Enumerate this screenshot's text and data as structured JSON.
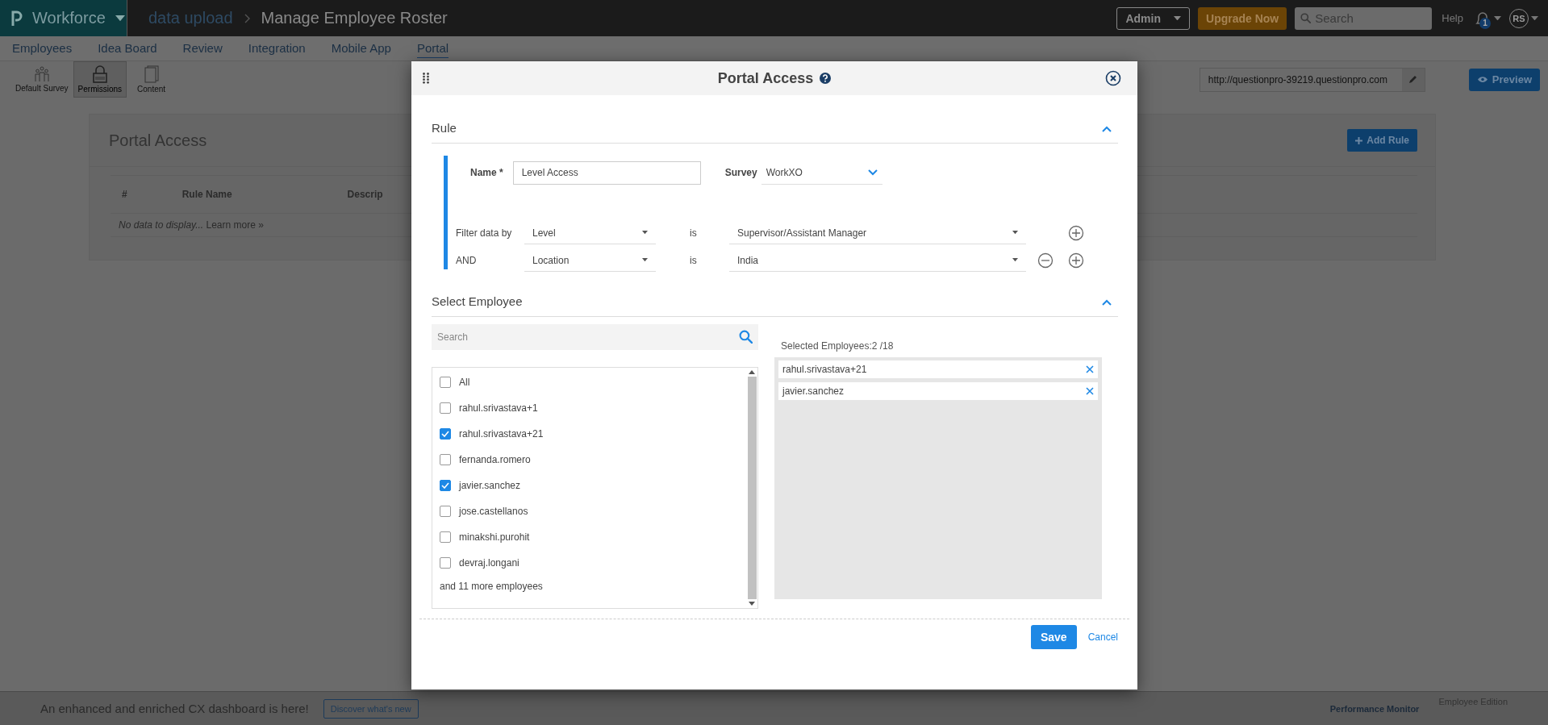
{
  "app_bar": {
    "product": "Workforce",
    "breadcrumb": [
      "data upload",
      "Manage Employee Roster"
    ],
    "role": "Admin",
    "upgrade": "Upgrade Now",
    "search": {
      "placeholder": "Search"
    },
    "help": "Help",
    "notification_count": "1",
    "avatar": "RS"
  },
  "nav_tabs": [
    {
      "label": "Employees",
      "selected": false
    },
    {
      "label": "Idea Board",
      "selected": false
    },
    {
      "label": "Review",
      "selected": false
    },
    {
      "label": "Integration",
      "selected": false
    },
    {
      "label": "Mobile App",
      "selected": false
    },
    {
      "label": "Portal",
      "selected": true
    }
  ],
  "toolbar": [
    {
      "label": "Default Survey",
      "selected": false
    },
    {
      "label": "Permissions",
      "selected": true
    },
    {
      "label": "Content",
      "selected": false
    }
  ],
  "portal_url": {
    "value": "http://questionpro-39219.questionpro.com"
  },
  "preview_button": "Preview",
  "page_card": {
    "title": "Portal Access",
    "add_rule": "Add Rule",
    "columns": [
      "#",
      "Rule Name",
      "Descrip"
    ],
    "empty_text": "No data to display...",
    "learn_more": "Learn more »"
  },
  "modal": {
    "title": "Portal Access",
    "rule_section": {
      "title": "Rule",
      "expanded": true
    },
    "name_field": {
      "label": "Name *",
      "value": "Level Access"
    },
    "survey": {
      "label": "Survey",
      "value": "WorkXO"
    },
    "filters": [
      {
        "connector": "Filter data by",
        "field": "Level",
        "operator": "is",
        "value": "Supervisor/Assistant Manager",
        "removable": false
      },
      {
        "connector": "AND",
        "field": "Location",
        "operator": "is",
        "value": "India",
        "removable": true
      }
    ],
    "employee_section": {
      "title": "Select Employee",
      "expanded": true
    },
    "employee_search": {
      "placeholder": "Search"
    },
    "employees": [
      {
        "name": "All",
        "checked": false
      },
      {
        "name": "rahul.srivastava+1",
        "checked": false
      },
      {
        "name": "rahul.srivastava+21",
        "checked": true
      },
      {
        "name": "fernanda.romero",
        "checked": false
      },
      {
        "name": "javier.sanchez",
        "checked": true
      },
      {
        "name": "jose.castellanos",
        "checked": false
      },
      {
        "name": "minakshi.purohit",
        "checked": false
      },
      {
        "name": "devraj.longani",
        "checked": false
      }
    ],
    "more_text": "and 11 more employees",
    "selected_label": "Selected Employees:2 /18",
    "selected_employees": [
      "rahul.srivastava+21",
      "javier.sanchez"
    ],
    "save": "Save",
    "cancel": "Cancel"
  },
  "footer_bar": {
    "message": "An enhanced and enriched CX dashboard is here!",
    "button": "Discover what's new",
    "links": [
      "Performance Monitor",
      "Employee Edition"
    ]
  }
}
